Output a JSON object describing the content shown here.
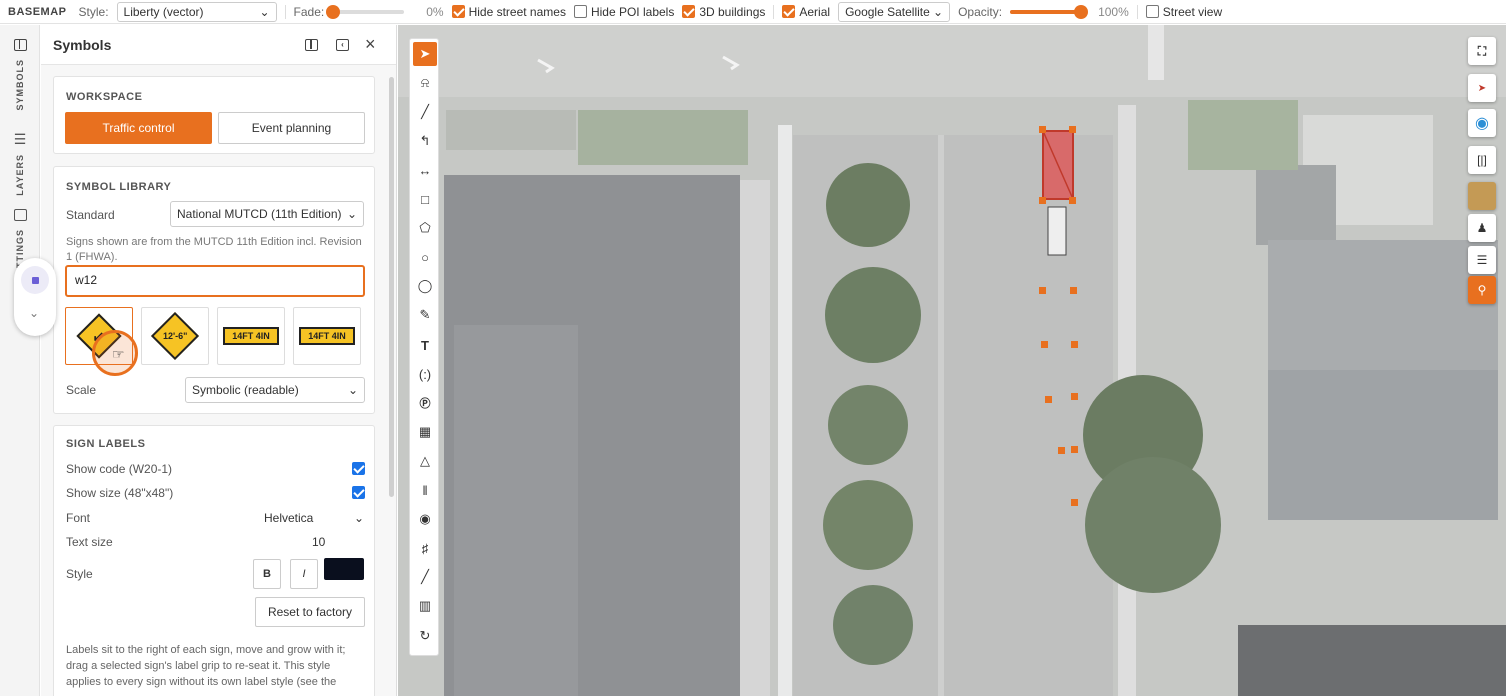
{
  "topbar": {
    "title": "BASEMAP",
    "style_label": "Style:",
    "style_value": "Liberty (vector)",
    "fade_label": "Fade:",
    "fade_value": "0%",
    "fade_level": 0,
    "hide_street_names": {
      "label": "Hide street names",
      "checked": true
    },
    "hide_poi_labels": {
      "label": "Hide POI labels",
      "checked": false
    },
    "buildings_3d": {
      "label": "3D buildings",
      "checked": true
    },
    "aerial": {
      "label": "Aerial",
      "checked": true
    },
    "imagery_value": "Google Satellite",
    "opacity_label": "Opacity:",
    "opacity_value": "100%",
    "opacity_level": 1,
    "street_view": {
      "label": "Street view",
      "checked": false
    }
  },
  "rail": {
    "tabs": [
      "SYMBOLS",
      "LAYERS",
      "SETTINGS"
    ]
  },
  "panel": {
    "title": "Symbols",
    "workspace": {
      "heading": "WORKSPACE",
      "options": [
        "Traffic control",
        "Event planning"
      ],
      "active": "Traffic control"
    },
    "library": {
      "heading": "SYMBOL LIBRARY",
      "standard_label": "Standard",
      "standard_value": "National MUTCD (11th Edition)",
      "note": "Signs shown are from the MUTCD 11th Edition incl. Revision 1 (FHWA).",
      "search_value": "w12",
      "thumbs": [
        {
          "name": "W12-1 double arrow",
          "text": ""
        },
        {
          "name": "W12-2 low clearance",
          "text": "12'-6\""
        },
        {
          "name": "W12-2aP clearance plaque",
          "text": "14FT 4IN"
        },
        {
          "name": "W12-2P clearance plaque arrow",
          "text": "14FT 4IN"
        }
      ],
      "scale_label": "Scale",
      "scale_value": "Symbolic (readable)"
    },
    "labels": {
      "heading": "SIGN LABELS",
      "show_code": {
        "label": "Show code (W20-1)",
        "checked": true
      },
      "show_size": {
        "label": "Show size (48\"x48\")",
        "checked": true
      },
      "font_label": "Font",
      "font_value": "Helvetica",
      "text_size_label": "Text size",
      "text_size_value": "10",
      "style_label": "Style",
      "bold": "B",
      "italic": "I",
      "color": "#0a0f1e",
      "reset": "Reset to factory",
      "help": "Labels sit to the right of each sign, move and grow with it; drag a selected sign's label grip to re-seat it. This style applies to every sign without its own label style (see the"
    }
  },
  "colors": {
    "accent": "#e8701f",
    "check_blue": "#1a73e8"
  },
  "icons": [
    "select-arrow-icon",
    "lasso-icon",
    "line-icon",
    "curve-icon",
    "double-arrow-icon",
    "rectangle-icon",
    "polygon-icon",
    "circle-icon",
    "ellipse-icon",
    "pencil-icon",
    "text-icon",
    "bracket-icon",
    "parking-icon",
    "crosswalk-icon",
    "node-icon",
    "road-icon",
    "target-icon",
    "rail-icon",
    "measure-icon",
    "hatch-icon",
    "rotate-icon"
  ]
}
